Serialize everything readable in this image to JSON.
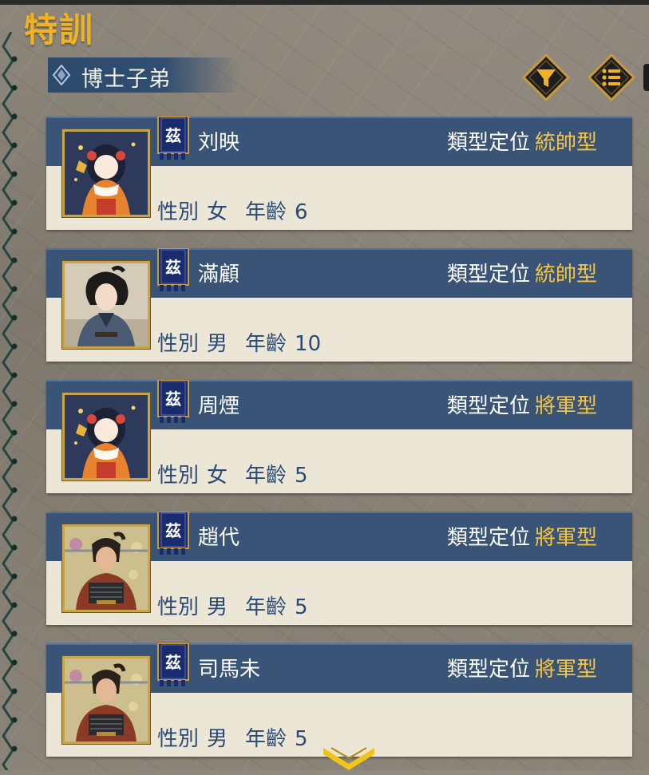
{
  "screen_title": "特訓",
  "section": {
    "title": "博士子弟"
  },
  "controls": {
    "filter_icon": "filter-icon",
    "list_icon": "list-icon"
  },
  "labels": {
    "type": "類型定位",
    "gender": "性別",
    "age": "年齡"
  },
  "colors": {
    "title_gold": "#f0b323",
    "band_blue": "#3a5478",
    "type_value_gold": "#f5c542",
    "info_blue": "#2a4a75",
    "card_bg": "#ece6d6"
  },
  "students": [
    {
      "banner": "茲",
      "name": "刘映",
      "type": "統帥型",
      "gender": "女",
      "age": "6",
      "portrait": "girl-flowers"
    },
    {
      "banner": "茲",
      "name": "滿顧",
      "type": "統帥型",
      "gender": "男",
      "age": "10",
      "portrait": "young-man"
    },
    {
      "banner": "茲",
      "name": "周煙",
      "type": "將軍型",
      "gender": "女",
      "age": "5",
      "portrait": "girl-flowers"
    },
    {
      "banner": "茲",
      "name": "趙代",
      "type": "將軍型",
      "gender": "男",
      "age": "5",
      "portrait": "armored-boy"
    },
    {
      "banner": "茲",
      "name": "司馬未",
      "type": "將軍型",
      "gender": "男",
      "age": "5",
      "portrait": "armored-boy"
    }
  ],
  "scroll_indicator": "chevron-down-icon"
}
